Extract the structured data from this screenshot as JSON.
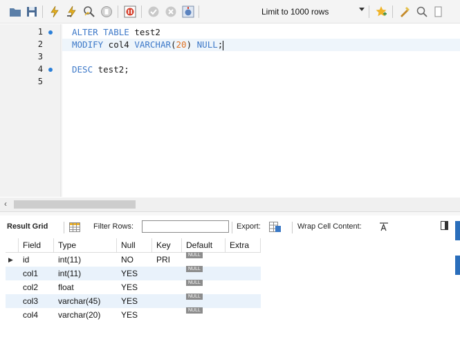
{
  "toolbar": {
    "limit_label": "Limit to 1000 rows",
    "icons": [
      "folder-icon",
      "save-icon",
      "execute-icon",
      "execute-current-icon",
      "explain-icon",
      "stop-icon",
      "toggle-stop-on-error-icon",
      "commit-icon",
      "rollback-icon",
      "autocommit-icon",
      "limit-dropdown-icon",
      "bookmark-icon",
      "beautify-icon",
      "find-icon"
    ]
  },
  "editor": {
    "lines": [
      {
        "num": "1",
        "marker": true
      },
      {
        "num": "2",
        "marker": false
      },
      {
        "num": "3",
        "marker": false
      },
      {
        "num": "4",
        "marker": true
      },
      {
        "num": "5",
        "marker": false
      }
    ],
    "line1": {
      "kw1": "ALTER TABLE",
      "ident": " test2"
    },
    "line2": {
      "kw1": "MODIFY",
      "ident": " col4 ",
      "kw2": "VARCHAR",
      "p1": "(",
      "n": "20",
      "p2": ")",
      "sp": " ",
      "kw3": "NULL",
      "semi": ";"
    },
    "line4": {
      "kw1": "DESC",
      "ident": " test2;"
    }
  },
  "result_bar": {
    "result_grid": "Result Grid",
    "filter_rows": "Filter Rows:",
    "filter_value": "",
    "export": "Export:",
    "wrap": "Wrap Cell Content:"
  },
  "grid": {
    "columns": [
      "Field",
      "Type",
      "Null",
      "Key",
      "Default",
      "Extra"
    ],
    "null_badge": "NULL",
    "rows": [
      {
        "field": "id",
        "type": "int(11)",
        "null": "NO",
        "key": "PRI",
        "extra": ""
      },
      {
        "field": "col1",
        "type": "int(11)",
        "null": "YES",
        "key": "",
        "extra": ""
      },
      {
        "field": "col2",
        "type": "float",
        "null": "YES",
        "key": "",
        "extra": ""
      },
      {
        "field": "col3",
        "type": "varchar(45)",
        "null": "YES",
        "key": "",
        "extra": ""
      },
      {
        "field": "col4",
        "type": "varchar(20)",
        "null": "YES",
        "key": "",
        "extra": ""
      }
    ]
  },
  "colors": {
    "keyword": "#3c78c8",
    "number": "#e07020",
    "row_alt": "#e9f2fb",
    "marker_dot": "#2b7fd8"
  }
}
